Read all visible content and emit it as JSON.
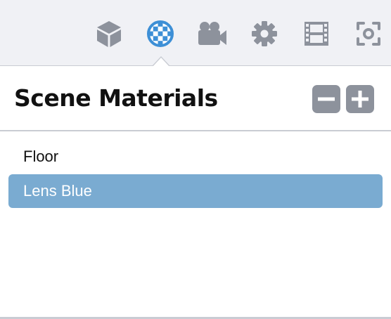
{
  "toolbar": {
    "tabs": [
      {
        "icon": "cube-icon",
        "active": false
      },
      {
        "icon": "material-checker-sphere-icon",
        "active": true
      },
      {
        "icon": "video-camera-icon",
        "active": false
      },
      {
        "icon": "gear-icon",
        "active": false
      },
      {
        "icon": "film-strip-icon",
        "active": false
      },
      {
        "icon": "focus-screenshot-icon",
        "active": false
      }
    ],
    "icon_color": "#8d929c",
    "active_color": "#3d8fd6"
  },
  "panel": {
    "title": "Scene Materials",
    "remove_icon": "minus-icon",
    "add_icon": "plus-icon"
  },
  "materials": {
    "items": [
      {
        "name": "Floor",
        "selected": false
      },
      {
        "name": "Lens Blue",
        "selected": true
      }
    ],
    "selection_color": "#7aabd1"
  }
}
